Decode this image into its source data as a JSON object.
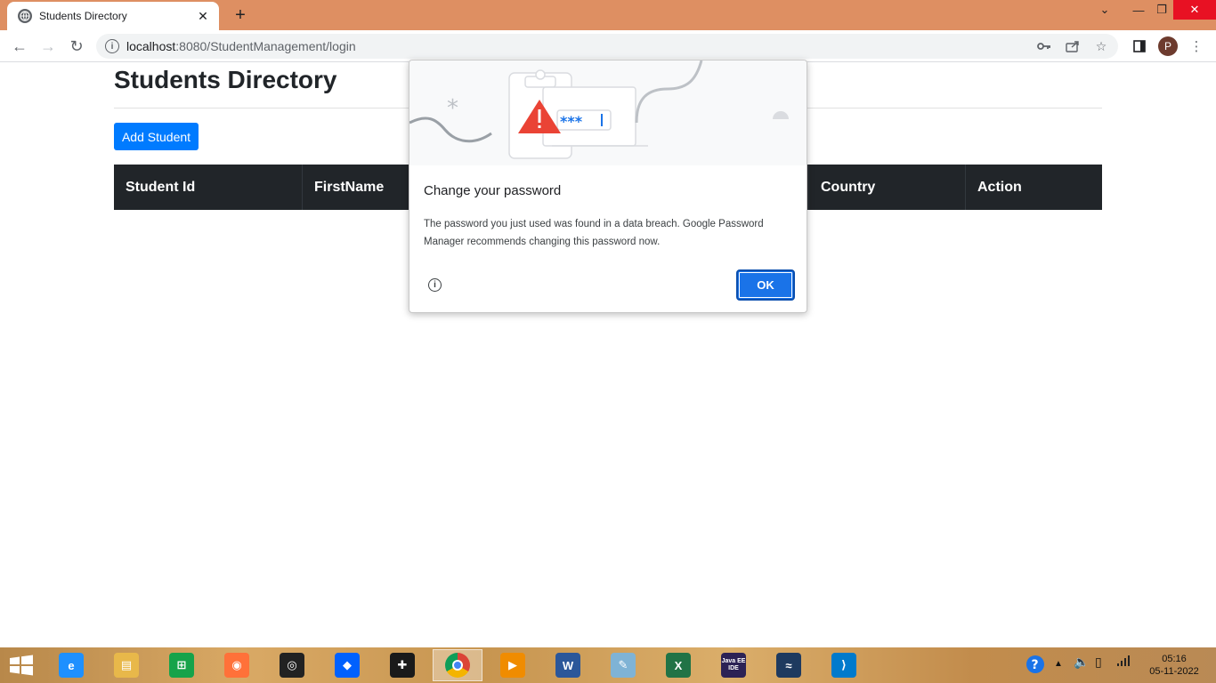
{
  "browser": {
    "tab_title": "Students Directory",
    "url_host": "localhost",
    "url_rest": ":8080/StudentManagement/login",
    "profile_initial": "P"
  },
  "page": {
    "heading": "Students Directory",
    "add_button": "Add Student",
    "columns": [
      "Student Id",
      "FirstName",
      "",
      "",
      "Country",
      "Action"
    ]
  },
  "dialog": {
    "title": "Change your password",
    "body": "The password you just used was found in a data breach. Google Password Manager recommends changing this password now.",
    "masked_password": "***",
    "ok_label": "OK"
  },
  "taskbar": {
    "apps": [
      {
        "name": "internet-explorer",
        "color": "#1e90ff"
      },
      {
        "name": "file-explorer",
        "color": "#e8b84a"
      },
      {
        "name": "store",
        "color": "#16a34a"
      },
      {
        "name": "firefox",
        "color": "#ff7139"
      },
      {
        "name": "camera-app",
        "color": "#222222"
      },
      {
        "name": "dropbox",
        "color": "#0061fe"
      },
      {
        "name": "puzzle-app",
        "color": "#1a1a1a"
      },
      {
        "name": "chrome",
        "color": "#db4437"
      },
      {
        "name": "media-player",
        "color": "#f08c00"
      },
      {
        "name": "word",
        "color": "#2b579a"
      },
      {
        "name": "notepad",
        "color": "#7fb3d5"
      },
      {
        "name": "excel",
        "color": "#217346"
      },
      {
        "name": "java-ee-ide",
        "color": "#2c2255"
      },
      {
        "name": "mysql-workbench",
        "color": "#1e3a5f"
      },
      {
        "name": "vscode",
        "color": "#007acc"
      }
    ],
    "java_label": "Java EE IDE",
    "time": "05:16",
    "date": "05-11-2022"
  }
}
